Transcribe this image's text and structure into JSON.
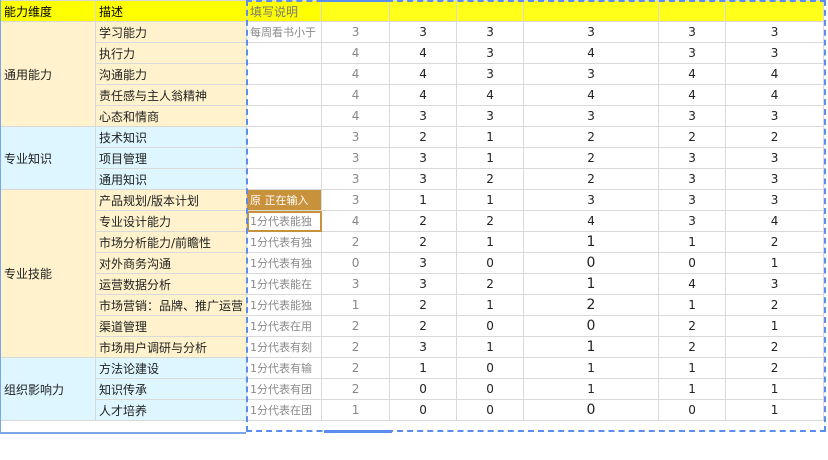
{
  "headers": {
    "dimension": "能力维度",
    "description": "描述",
    "note": "填写说明",
    "person_cols": [
      "",
      "",
      "",
      "",
      "",
      ""
    ]
  },
  "groups": [
    {
      "name": "通用能力",
      "color": "yellow",
      "rows": [
        {
          "desc": "学习能力",
          "note": "每周看书小于",
          "values": [
            3,
            3,
            3,
            3,
            3,
            3
          ]
        },
        {
          "desc": "执行力",
          "note": "",
          "values": [
            4,
            4,
            3,
            4,
            3,
            3
          ]
        },
        {
          "desc": "沟通能力",
          "note": "",
          "values": [
            4,
            4,
            3,
            3,
            4,
            4
          ]
        },
        {
          "desc": "责任感与主人翁精神",
          "note": "",
          "values": [
            4,
            4,
            4,
            4,
            4,
            4
          ]
        },
        {
          "desc": "心态和情商",
          "note": "",
          "values": [
            4,
            3,
            3,
            3,
            3,
            3
          ]
        }
      ]
    },
    {
      "name": "专业知识",
      "color": "blue",
      "rows": [
        {
          "desc": "技术知识",
          "note": "",
          "values": [
            3,
            2,
            1,
            2,
            2,
            2
          ]
        },
        {
          "desc": "项目管理",
          "note": "",
          "values": [
            3,
            3,
            1,
            2,
            3,
            3
          ]
        },
        {
          "desc": "通用知识",
          "note": "",
          "values": [
            3,
            3,
            2,
            2,
            3,
            3
          ]
        }
      ]
    },
    {
      "name": "专业技能",
      "color": "yellow",
      "rows": [
        {
          "desc": "产品规划/版本计划",
          "note": "原 正在输入",
          "values": [
            3,
            1,
            1,
            3,
            3,
            3
          ]
        },
        {
          "desc": "专业设计能力",
          "note": "1分代表能独",
          "values": [
            4,
            2,
            2,
            4,
            3,
            4
          ]
        },
        {
          "desc": "市场分析能力/前瞻性",
          "note": "1分代表有独",
          "values": [
            2,
            2,
            1,
            1,
            1,
            2
          ]
        },
        {
          "desc": "对外商务沟通",
          "note": "1分代表有独",
          "values": [
            0,
            3,
            0,
            0,
            0,
            1
          ]
        },
        {
          "desc": "运营数据分析",
          "note": "1分代表能在",
          "values": [
            3,
            3,
            2,
            1,
            4,
            3
          ]
        },
        {
          "desc": "市场营销：品牌、推广运营",
          "note": "1分代表能独",
          "values": [
            1,
            2,
            1,
            2,
            1,
            2
          ]
        },
        {
          "desc": "渠道管理",
          "note": "1分代表在用",
          "values": [
            2,
            2,
            0,
            0,
            2,
            1
          ]
        },
        {
          "desc": "市场用户调研与分析",
          "note": "1分代表有刻",
          "values": [
            2,
            3,
            1,
            1,
            2,
            2
          ]
        }
      ]
    },
    {
      "name": "组织影响力",
      "color": "blue",
      "rows": [
        {
          "desc": "方法论建设",
          "note": "1分代表有输",
          "values": [
            2,
            1,
            0,
            1,
            1,
            2
          ]
        },
        {
          "desc": "知识传承",
          "note": "1分代表有团",
          "values": [
            2,
            0,
            0,
            1,
            1,
            1
          ]
        },
        {
          "desc": "人才培养",
          "note": "1分代表在团",
          "values": [
            1,
            0,
            0,
            0,
            0,
            1
          ]
        }
      ]
    }
  ],
  "colors": {
    "header": "#ffff00",
    "group_yellow": "#fff2cc",
    "group_blue": "#ddf6ff",
    "editing": "#c8923d",
    "selection": "#5b8def"
  }
}
